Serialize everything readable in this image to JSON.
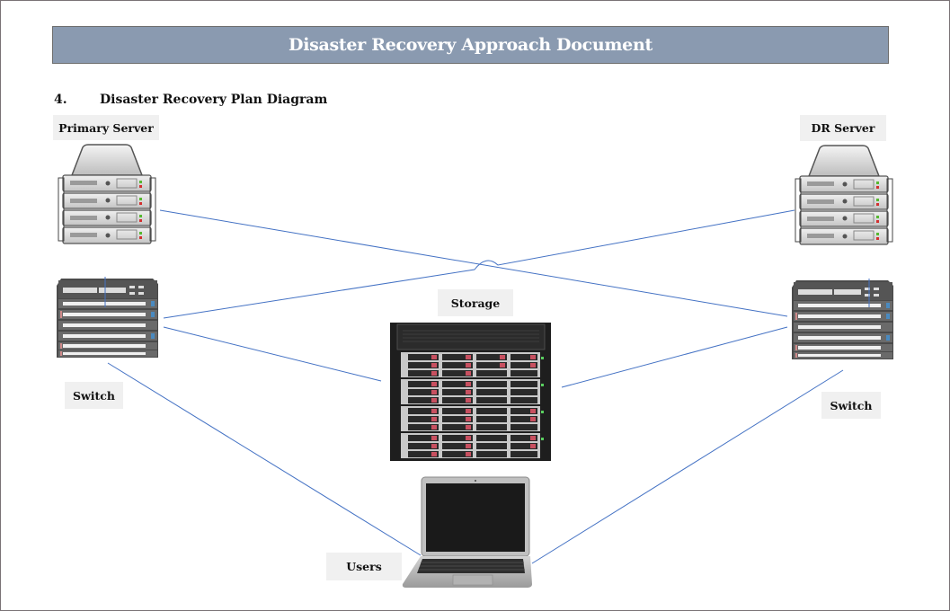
{
  "document": {
    "title": "Disaster Recovery Approach Document",
    "section_number": "4.",
    "section_title": "Disaster Recovery Plan Diagram"
  },
  "diagram": {
    "line_color": "#4472c4",
    "nodes": {
      "primary_server": {
        "label": "Primary Server",
        "icon": "server-stack-icon"
      },
      "dr_server": {
        "label": "DR Server",
        "icon": "server-stack-icon"
      },
      "primary_switch": {
        "label": "Switch",
        "icon": "network-switch-icon"
      },
      "dr_switch": {
        "label": "Switch",
        "icon": "network-switch-icon"
      },
      "storage": {
        "label": "Storage",
        "icon": "storage-array-icon"
      },
      "users": {
        "label": "Users",
        "icon": "laptop-icon"
      }
    },
    "connections": [
      {
        "from": "primary_server",
        "to": "dr_switch"
      },
      {
        "from": "primary_switch",
        "to": "dr_server"
      },
      {
        "from": "primary_switch",
        "to": "storage"
      },
      {
        "from": "dr_switch",
        "to": "storage"
      },
      {
        "from": "primary_switch",
        "to": "users"
      },
      {
        "from": "dr_switch",
        "to": "users"
      }
    ]
  }
}
